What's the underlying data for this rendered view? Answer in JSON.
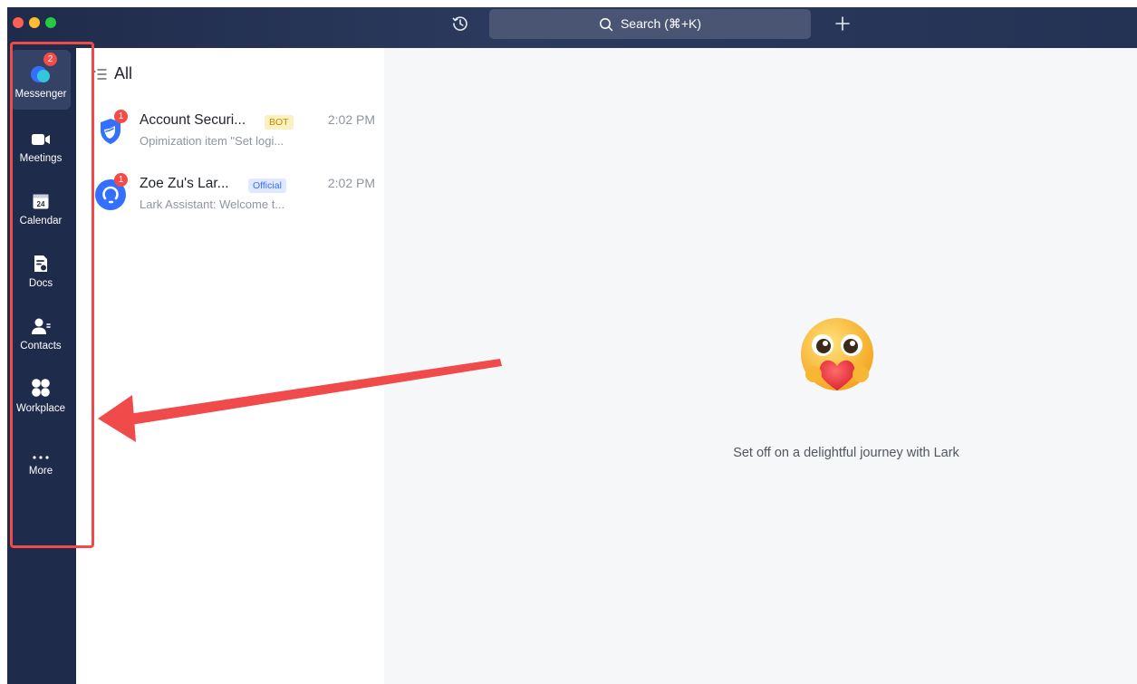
{
  "search": {
    "label": "Search (⌘+K)"
  },
  "nav": {
    "items": [
      {
        "label": "Messenger",
        "icon": "messenger-icon",
        "badge": "2"
      },
      {
        "label": "Meetings",
        "icon": "video-camera-icon"
      },
      {
        "label": "Calendar",
        "icon": "calendar-icon",
        "day": "24"
      },
      {
        "label": "Docs",
        "icon": "docs-icon"
      },
      {
        "label": "Contacts",
        "icon": "contacts-icon"
      },
      {
        "label": "Workplace",
        "icon": "workplace-icon"
      },
      {
        "label": "More",
        "icon": "more-icon"
      }
    ]
  },
  "chatlist": {
    "header": "All",
    "chats": [
      {
        "name": "Account Securi...",
        "tag": "BOT",
        "time": "2:02 PM",
        "preview": "Opimization item \"Set logi...",
        "unread": "1"
      },
      {
        "name": "Zoe Zu's Lar...",
        "tag": "Official",
        "time": "2:02 PM",
        "preview": "Lark Assistant: Welcome t...",
        "unread": "1"
      }
    ]
  },
  "main": {
    "empty_text": "Set off on a delightful journey with Lark"
  },
  "colors": {
    "sidebar": "#1f2b4a",
    "accent": "#3370ff",
    "badge": "#f54a45",
    "annotation": "#f04a4a"
  }
}
